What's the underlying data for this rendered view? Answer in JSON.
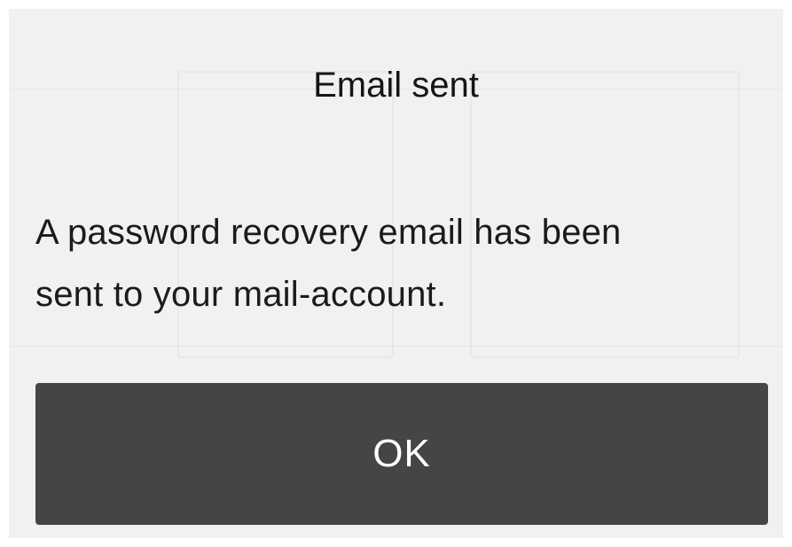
{
  "dialog": {
    "title": "Email sent",
    "message_line1": "A password recovery email has been",
    "message_line2": "sent to your mail-account.",
    "ok_label": "OK"
  },
  "colors": {
    "backdrop": "#f1f1f1",
    "button_background": "#454545",
    "button_text": "#ffffff",
    "text": "#151515"
  }
}
